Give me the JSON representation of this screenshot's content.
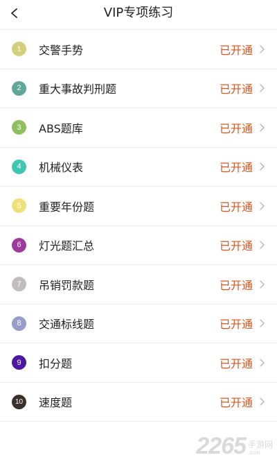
{
  "header": {
    "title": "VIP专项练习",
    "back_icon": "chevron-left-icon"
  },
  "colors": {
    "status": "#e0531b",
    "text": "#222222",
    "divider": "#eeeeee"
  },
  "items": [
    {
      "num": "1",
      "label": "交警手势",
      "status": "已开通",
      "color": "#d4cf7a"
    },
    {
      "num": "2",
      "label": "重大事故判刑题",
      "status": "已开通",
      "color": "#5fa79a"
    },
    {
      "num": "3",
      "label": "ABS题库",
      "status": "已开通",
      "color": "#8fbf5e"
    },
    {
      "num": "4",
      "label": "机械仪表",
      "status": "已开通",
      "color": "#3fc8b0"
    },
    {
      "num": "5",
      "label": "重要年份题",
      "status": "已开通",
      "color": "#ece17a"
    },
    {
      "num": "6",
      "label": "灯光题汇总",
      "status": "已开通",
      "color": "#9c3b9b"
    },
    {
      "num": "7",
      "label": "吊销罚款题",
      "status": "已开通",
      "color": "#c3bcbe"
    },
    {
      "num": "8",
      "label": "交通标线题",
      "status": "已开通",
      "color": "#9a9cc9"
    },
    {
      "num": "9",
      "label": "扣分题",
      "status": "已开通",
      "color": "#4a1ba0"
    },
    {
      "num": "10",
      "label": "速度题",
      "status": "已开通",
      "color": "#3a302a"
    }
  ],
  "watermark": {
    "number": "2265",
    "text": "手游网",
    "domain": ".com"
  }
}
